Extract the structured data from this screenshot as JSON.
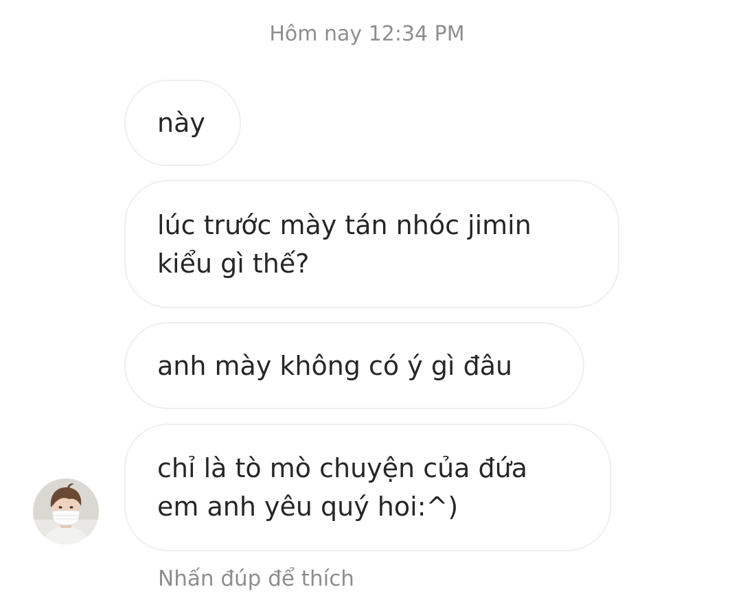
{
  "conversation": {
    "timestamp": "Hôm nay 12:34 PM",
    "messages": [
      {
        "lines": [
          "này"
        ]
      },
      {
        "lines": [
          "lúc trước mày tán nhóc jimin",
          "kiểu gì thế?"
        ]
      },
      {
        "lines": [
          "anh mày không có ý gì đâu"
        ]
      },
      {
        "lines": [
          "chỉ là tò mò chuyện của đứa",
          "em anh yêu quý hoi:^)"
        ]
      }
    ],
    "sender": {
      "avatar_icon": "profile-photo-masked-person"
    },
    "double_tap_hint": "Nhấn đúp để thích"
  },
  "colors": {
    "background": "#ffffff",
    "bubble_border": "#efefef",
    "message_text": "#262626",
    "secondary_text": "#8e8e8e"
  }
}
